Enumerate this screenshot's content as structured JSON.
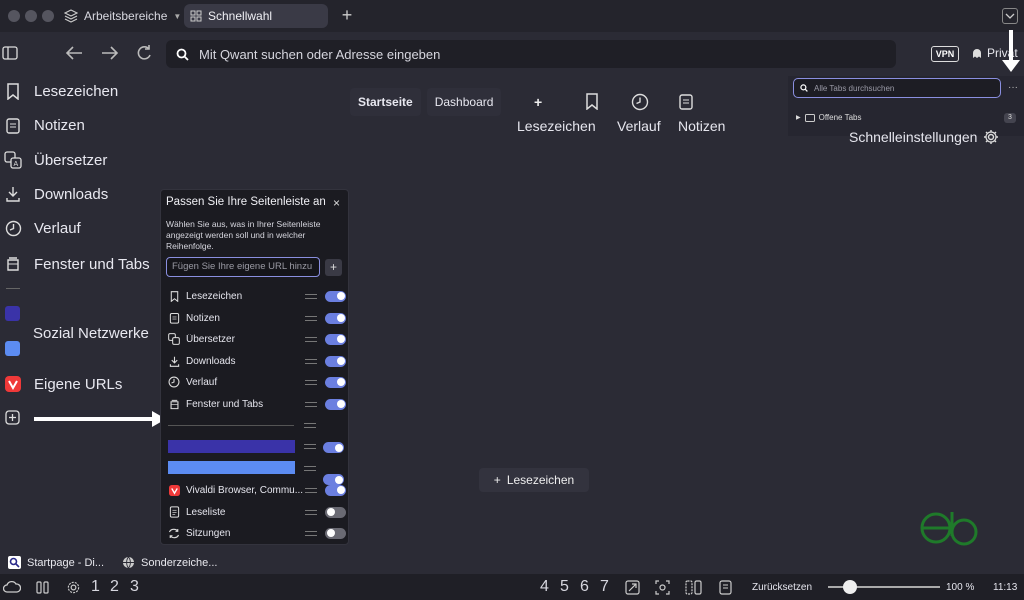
{
  "tabbar": {
    "workspaces_label": "Arbeitsbereiche",
    "active_tab_label": "Schnellwahl",
    "new_tab_symbol": "+"
  },
  "address": {
    "placeholder": "Mit Qwant suchen oder Adresse eingeben",
    "vpn_label": "VPN",
    "private_label": "Privat"
  },
  "sidebar": {
    "items": [
      {
        "label": "Lesezeichen",
        "icon": "bookmark-icon"
      },
      {
        "label": "Notizen",
        "icon": "notes-icon"
      },
      {
        "label": "Übersetzer",
        "icon": "translate-icon"
      },
      {
        "label": "Downloads",
        "icon": "download-icon"
      },
      {
        "label": "Verlauf",
        "icon": "history-icon"
      },
      {
        "label": "Fenster und Tabs",
        "icon": "window-icon"
      },
      {
        "label": "Sozial Netzwerke",
        "icon": "social-square-icons"
      },
      {
        "label": "Eigene URLs",
        "icon": "vivaldi-icon"
      }
    ]
  },
  "startpage": {
    "tabs": [
      "Startseite",
      "Dashboard"
    ],
    "buttons": [
      {
        "label": "Lesezeichen",
        "icon": "plus-icon"
      },
      {
        "label": "Verlauf",
        "icon": "bookmark-icon"
      },
      {
        "label": "Notizen",
        "icon": "history-icon"
      }
    ],
    "button_icons_extra": "notes-icon",
    "add_bookmark_label": "Lesezeichen"
  },
  "tab_panel": {
    "search_placeholder": "Alle Tabs durchsuchen",
    "section_label": "Offene Tabs",
    "section_count": "3",
    "quick_settings_label": "Schnelleinstellungen"
  },
  "popup": {
    "title": "Passen Sie Ihre Seitenleiste an",
    "description": "Wählen Sie aus, was in Ihrer Seitenleiste angezeigt werden soll und in welcher Reihenfolge.",
    "url_placeholder": "Fügen Sie Ihre eigene URL hinzu",
    "rows": [
      {
        "label": "Lesezeichen",
        "on": true
      },
      {
        "label": "Notizen",
        "on": true
      },
      {
        "label": "Übersetzer",
        "on": true
      },
      {
        "label": "Downloads",
        "on": true
      },
      {
        "label": "Verlauf",
        "on": true
      },
      {
        "label": "Fenster und Tabs",
        "on": true
      },
      {
        "label": "Vivaldi Browser, Commu...",
        "on": true
      },
      {
        "label": "Leseliste",
        "on": false
      },
      {
        "label": "Sitzungen",
        "on": false
      }
    ],
    "colors": {
      "panel_a": "#3a33a8",
      "panel_b": "#5c8cf2",
      "accent": "#6b7fe0"
    }
  },
  "bookmark_bar": [
    {
      "label": "Startpage - Di..."
    },
    {
      "label": "Sonderzeiche..."
    }
  ],
  "statusbar": {
    "workspaces_left": [
      "1",
      "2",
      "3"
    ],
    "workspaces_right": [
      "4",
      "5",
      "6",
      "7"
    ],
    "reset_label": "Zurücksetzen",
    "zoom_label": "100 %",
    "zoom_level": 0.2,
    "clock": "11:13"
  }
}
